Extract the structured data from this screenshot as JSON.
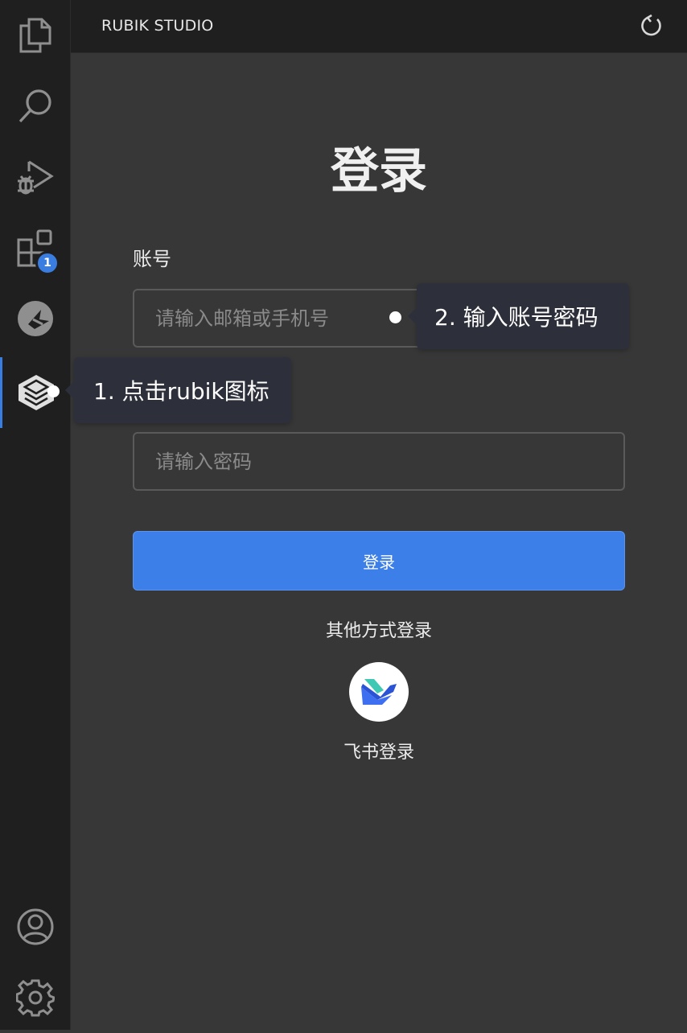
{
  "app": {
    "title": "RUBIK STUDIO"
  },
  "activity_bar": {
    "items": [
      {
        "name": "explorer",
        "icon": "files-icon"
      },
      {
        "name": "search",
        "icon": "search-icon"
      },
      {
        "name": "run-debug",
        "icon": "run-debug-icon"
      },
      {
        "name": "extensions",
        "icon": "extensions-icon",
        "badge": "1"
      },
      {
        "name": "app",
        "icon": "app-logo-icon"
      },
      {
        "name": "rubik",
        "icon": "rubik-icon",
        "active": true
      }
    ],
    "bottom": [
      {
        "name": "accounts",
        "icon": "account-icon"
      },
      {
        "name": "settings",
        "icon": "gear-icon"
      }
    ]
  },
  "login": {
    "title": "登录",
    "account_label": "账号",
    "account_placeholder": "请输入邮箱或手机号",
    "password_placeholder": "请输入密码",
    "submit_label": "登录",
    "other_methods_label": "其他方式登录",
    "feishu_label": "飞书登录"
  },
  "tooltips": {
    "step1": "1. 点击rubik图标",
    "step2": "2. 输入账号密码"
  },
  "colors": {
    "accent": "#3d7fe8",
    "sidebar_bg": "#1f1f1f",
    "panel_bg": "#373737",
    "tooltip_bg": "#2d303a"
  }
}
